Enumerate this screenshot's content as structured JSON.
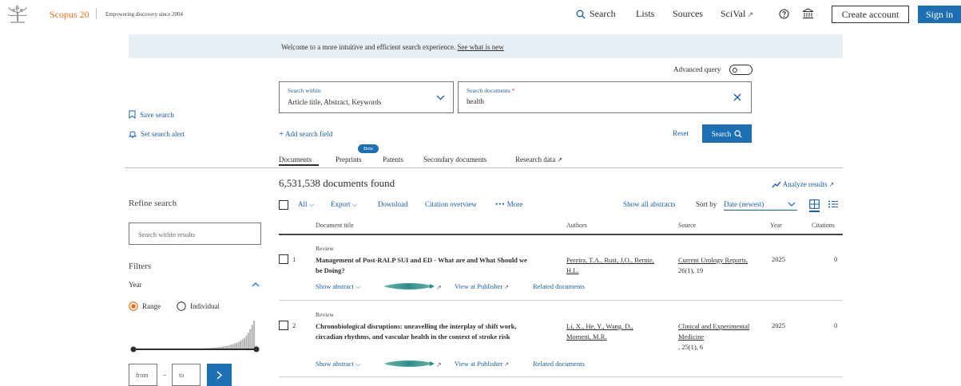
{
  "header": {
    "brand": "Scopus 20",
    "tagline": "Empowering discovery since 2004",
    "nav": {
      "search": "Search",
      "lists": "Lists",
      "sources": "Sources",
      "scival": "SciVal"
    },
    "create_account": "Create account",
    "sign_in": "Sign in"
  },
  "banner": {
    "text": "Welcome to a more intuitive and efficient search experience.",
    "link": "See what is new"
  },
  "search": {
    "advanced_query": "Advanced query",
    "search_within_label": "Search within",
    "search_within_value": "Article title, Abstract, Keywords",
    "search_documents_label": "Search documents",
    "required_mark": "*",
    "query": "health",
    "add_field": "Add search field",
    "reset": "Reset",
    "search_button": "Search"
  },
  "sidebar": {
    "save_search": "Save search",
    "set_alert": "Set search alert",
    "refine": "Refine search",
    "search_within_results": "Search within results",
    "filters": "Filters",
    "year": "Year",
    "range": "Range",
    "individual": "Individual",
    "from": "from",
    "dash": "–",
    "to": "to",
    "histogram": [
      0.04,
      0.04,
      0.05,
      0.05,
      0.06,
      0.06,
      0.07,
      0.08,
      0.09,
      0.1,
      0.11,
      0.12,
      0.14,
      0.16,
      0.18,
      0.2,
      0.23,
      0.26,
      0.3,
      0.35,
      0.4,
      0.48,
      0.58,
      0.7,
      0.85,
      1.0,
      0.12
    ]
  },
  "tabs": [
    {
      "label": "Documents"
    },
    {
      "label": "Preprints",
      "badge": "Beta"
    },
    {
      "label": "Patents"
    },
    {
      "label": "Secondary documents"
    },
    {
      "label": "Research data"
    }
  ],
  "results": {
    "count_text": "6,531,538 documents found",
    "analyze": "Analyze results",
    "toolbar": {
      "all": "All",
      "export": "Export",
      "download": "Download",
      "citation_overview": "Citation overview",
      "more": "More",
      "show_all_abstracts": "Show all abstracts",
      "sort_by": "Sort by",
      "sort_value": "Date (newest)"
    },
    "columns": {
      "title": "Document title",
      "authors": "Authors",
      "source": "Source",
      "year": "Year",
      "citations": "Citations"
    },
    "rows": [
      {
        "num": "1",
        "type": "Review",
        "title": "Management of Post-RALP SUI and ED - What are and What Should we be Doing?",
        "authors": "Pereira, T.A., Rust, J.O., Bernie, H.L.",
        "source_title": "Current Urology Reports,",
        "source_detail": "26(1), 19",
        "year": "2025",
        "citations": "0",
        "show_abstract": "Show abstract",
        "view_publisher": "View at Publisher",
        "related": "Related documents"
      },
      {
        "num": "2",
        "type": "Review",
        "title": "Chronobiological disruptions: unravelling the interplay of shift work, circadian rhythms, and vascular health in the context of stroke risk",
        "authors": "Li, X., He, Y., Wang, D., Momeni, M.R.",
        "source_title": "Clinical and Experimental Medicine",
        "source_detail": ", 25(1), 6",
        "year": "2025",
        "citations": "0",
        "show_abstract": "Show abstract",
        "view_publisher": "View at Publisher",
        "related": "Related documents"
      }
    ]
  },
  "colors": {
    "brand_orange": "#e9711c",
    "accent_blue": "#1b6fb2",
    "link_blue": "#1a5da6",
    "banner_bg": "#e8eff5"
  }
}
